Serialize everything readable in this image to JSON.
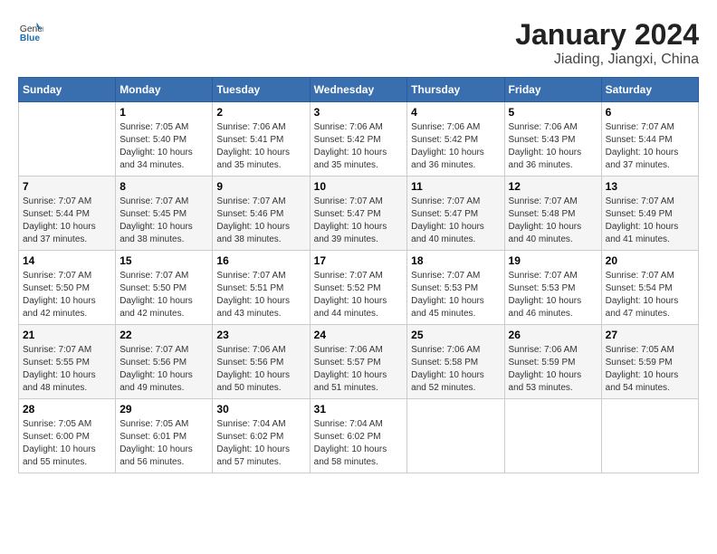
{
  "logo": {
    "general": "General",
    "blue": "Blue"
  },
  "title": "January 2024",
  "subtitle": "Jiading, Jiangxi, China",
  "headers": [
    "Sunday",
    "Monday",
    "Tuesday",
    "Wednesday",
    "Thursday",
    "Friday",
    "Saturday"
  ],
  "weeks": [
    [
      {
        "day": "",
        "sunrise": "",
        "sunset": "",
        "daylight": ""
      },
      {
        "day": "1",
        "sunrise": "Sunrise: 7:05 AM",
        "sunset": "Sunset: 5:40 PM",
        "daylight": "Daylight: 10 hours and 34 minutes."
      },
      {
        "day": "2",
        "sunrise": "Sunrise: 7:06 AM",
        "sunset": "Sunset: 5:41 PM",
        "daylight": "Daylight: 10 hours and 35 minutes."
      },
      {
        "day": "3",
        "sunrise": "Sunrise: 7:06 AM",
        "sunset": "Sunset: 5:42 PM",
        "daylight": "Daylight: 10 hours and 35 minutes."
      },
      {
        "day": "4",
        "sunrise": "Sunrise: 7:06 AM",
        "sunset": "Sunset: 5:42 PM",
        "daylight": "Daylight: 10 hours and 36 minutes."
      },
      {
        "day": "5",
        "sunrise": "Sunrise: 7:06 AM",
        "sunset": "Sunset: 5:43 PM",
        "daylight": "Daylight: 10 hours and 36 minutes."
      },
      {
        "day": "6",
        "sunrise": "Sunrise: 7:07 AM",
        "sunset": "Sunset: 5:44 PM",
        "daylight": "Daylight: 10 hours and 37 minutes."
      }
    ],
    [
      {
        "day": "7",
        "sunrise": "Sunrise: 7:07 AM",
        "sunset": "Sunset: 5:44 PM",
        "daylight": "Daylight: 10 hours and 37 minutes."
      },
      {
        "day": "8",
        "sunrise": "Sunrise: 7:07 AM",
        "sunset": "Sunset: 5:45 PM",
        "daylight": "Daylight: 10 hours and 38 minutes."
      },
      {
        "day": "9",
        "sunrise": "Sunrise: 7:07 AM",
        "sunset": "Sunset: 5:46 PM",
        "daylight": "Daylight: 10 hours and 38 minutes."
      },
      {
        "day": "10",
        "sunrise": "Sunrise: 7:07 AM",
        "sunset": "Sunset: 5:47 PM",
        "daylight": "Daylight: 10 hours and 39 minutes."
      },
      {
        "day": "11",
        "sunrise": "Sunrise: 7:07 AM",
        "sunset": "Sunset: 5:47 PM",
        "daylight": "Daylight: 10 hours and 40 minutes."
      },
      {
        "day": "12",
        "sunrise": "Sunrise: 7:07 AM",
        "sunset": "Sunset: 5:48 PM",
        "daylight": "Daylight: 10 hours and 40 minutes."
      },
      {
        "day": "13",
        "sunrise": "Sunrise: 7:07 AM",
        "sunset": "Sunset: 5:49 PM",
        "daylight": "Daylight: 10 hours and 41 minutes."
      }
    ],
    [
      {
        "day": "14",
        "sunrise": "Sunrise: 7:07 AM",
        "sunset": "Sunset: 5:50 PM",
        "daylight": "Daylight: 10 hours and 42 minutes."
      },
      {
        "day": "15",
        "sunrise": "Sunrise: 7:07 AM",
        "sunset": "Sunset: 5:50 PM",
        "daylight": "Daylight: 10 hours and 42 minutes."
      },
      {
        "day": "16",
        "sunrise": "Sunrise: 7:07 AM",
        "sunset": "Sunset: 5:51 PM",
        "daylight": "Daylight: 10 hours and 43 minutes."
      },
      {
        "day": "17",
        "sunrise": "Sunrise: 7:07 AM",
        "sunset": "Sunset: 5:52 PM",
        "daylight": "Daylight: 10 hours and 44 minutes."
      },
      {
        "day": "18",
        "sunrise": "Sunrise: 7:07 AM",
        "sunset": "Sunset: 5:53 PM",
        "daylight": "Daylight: 10 hours and 45 minutes."
      },
      {
        "day": "19",
        "sunrise": "Sunrise: 7:07 AM",
        "sunset": "Sunset: 5:53 PM",
        "daylight": "Daylight: 10 hours and 46 minutes."
      },
      {
        "day": "20",
        "sunrise": "Sunrise: 7:07 AM",
        "sunset": "Sunset: 5:54 PM",
        "daylight": "Daylight: 10 hours and 47 minutes."
      }
    ],
    [
      {
        "day": "21",
        "sunrise": "Sunrise: 7:07 AM",
        "sunset": "Sunset: 5:55 PM",
        "daylight": "Daylight: 10 hours and 48 minutes."
      },
      {
        "day": "22",
        "sunrise": "Sunrise: 7:07 AM",
        "sunset": "Sunset: 5:56 PM",
        "daylight": "Daylight: 10 hours and 49 minutes."
      },
      {
        "day": "23",
        "sunrise": "Sunrise: 7:06 AM",
        "sunset": "Sunset: 5:56 PM",
        "daylight": "Daylight: 10 hours and 50 minutes."
      },
      {
        "day": "24",
        "sunrise": "Sunrise: 7:06 AM",
        "sunset": "Sunset: 5:57 PM",
        "daylight": "Daylight: 10 hours and 51 minutes."
      },
      {
        "day": "25",
        "sunrise": "Sunrise: 7:06 AM",
        "sunset": "Sunset: 5:58 PM",
        "daylight": "Daylight: 10 hours and 52 minutes."
      },
      {
        "day": "26",
        "sunrise": "Sunrise: 7:06 AM",
        "sunset": "Sunset: 5:59 PM",
        "daylight": "Daylight: 10 hours and 53 minutes."
      },
      {
        "day": "27",
        "sunrise": "Sunrise: 7:05 AM",
        "sunset": "Sunset: 5:59 PM",
        "daylight": "Daylight: 10 hours and 54 minutes."
      }
    ],
    [
      {
        "day": "28",
        "sunrise": "Sunrise: 7:05 AM",
        "sunset": "Sunset: 6:00 PM",
        "daylight": "Daylight: 10 hours and 55 minutes."
      },
      {
        "day": "29",
        "sunrise": "Sunrise: 7:05 AM",
        "sunset": "Sunset: 6:01 PM",
        "daylight": "Daylight: 10 hours and 56 minutes."
      },
      {
        "day": "30",
        "sunrise": "Sunrise: 7:04 AM",
        "sunset": "Sunset: 6:02 PM",
        "daylight": "Daylight: 10 hours and 57 minutes."
      },
      {
        "day": "31",
        "sunrise": "Sunrise: 7:04 AM",
        "sunset": "Sunset: 6:02 PM",
        "daylight": "Daylight: 10 hours and 58 minutes."
      },
      {
        "day": "",
        "sunrise": "",
        "sunset": "",
        "daylight": ""
      },
      {
        "day": "",
        "sunrise": "",
        "sunset": "",
        "daylight": ""
      },
      {
        "day": "",
        "sunrise": "",
        "sunset": "",
        "daylight": ""
      }
    ]
  ]
}
